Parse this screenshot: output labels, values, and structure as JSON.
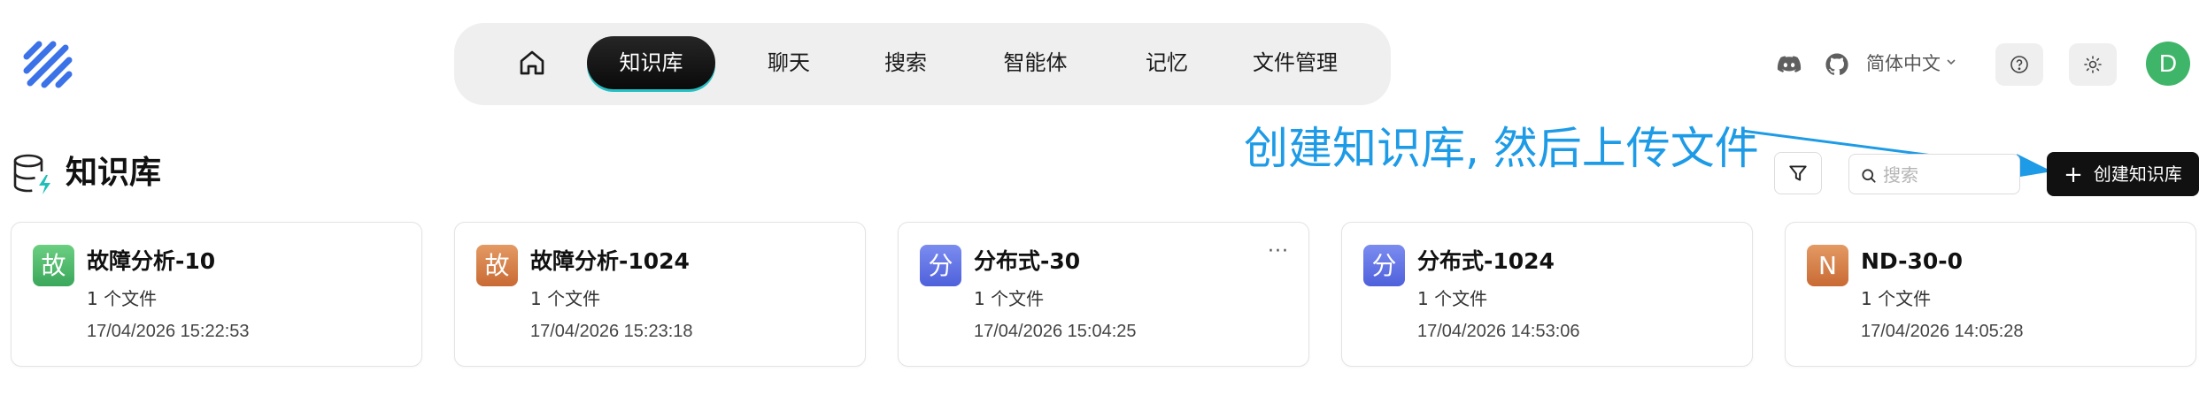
{
  "nav": {
    "home_icon": "home-icon",
    "tabs": [
      {
        "label": "知识库",
        "active": true
      },
      {
        "label": "聊天"
      },
      {
        "label": "搜索"
      },
      {
        "label": "智能体"
      },
      {
        "label": "记忆"
      },
      {
        "label": "文件管理"
      }
    ]
  },
  "header": {
    "language": "简体中文",
    "avatar_initial": "D",
    "icons": [
      "discord-icon",
      "github-icon",
      "help-icon",
      "theme-sun-icon"
    ]
  },
  "page": {
    "title": "知识库",
    "annotation": "创建知识库, 然后上传文件",
    "search_placeholder": "搜索",
    "create_button": "创建知识库",
    "create_plus": "+"
  },
  "cards": [
    {
      "icon_text": "故",
      "title": "故障分析-10",
      "count": "1 个文件",
      "date": "17/04/2026 15:22:53",
      "color": "#4cb96a"
    },
    {
      "icon_text": "故",
      "title": "故障分析-1024",
      "count": "1 个文件",
      "date": "17/04/2026 15:23:18",
      "color": "#d97d45"
    },
    {
      "icon_text": "分",
      "title": "分布式-30",
      "count": "1 个文件",
      "date": "17/04/2026 15:04:25",
      "color": "#5b6fe6",
      "more": "···"
    },
    {
      "icon_text": "分",
      "title": "分布式-1024",
      "count": "1 个文件",
      "date": "17/04/2026 14:53:06",
      "color": "#5b6fe6"
    },
    {
      "icon_text": "N",
      "title": "ND-30-0",
      "count": "1 个文件",
      "date": "17/04/2026 14:05:28",
      "color": "#d97d45"
    }
  ],
  "colors": {
    "accent": "#111111",
    "annotation": "#1e9be6",
    "active_underline": "#22c1c3"
  }
}
